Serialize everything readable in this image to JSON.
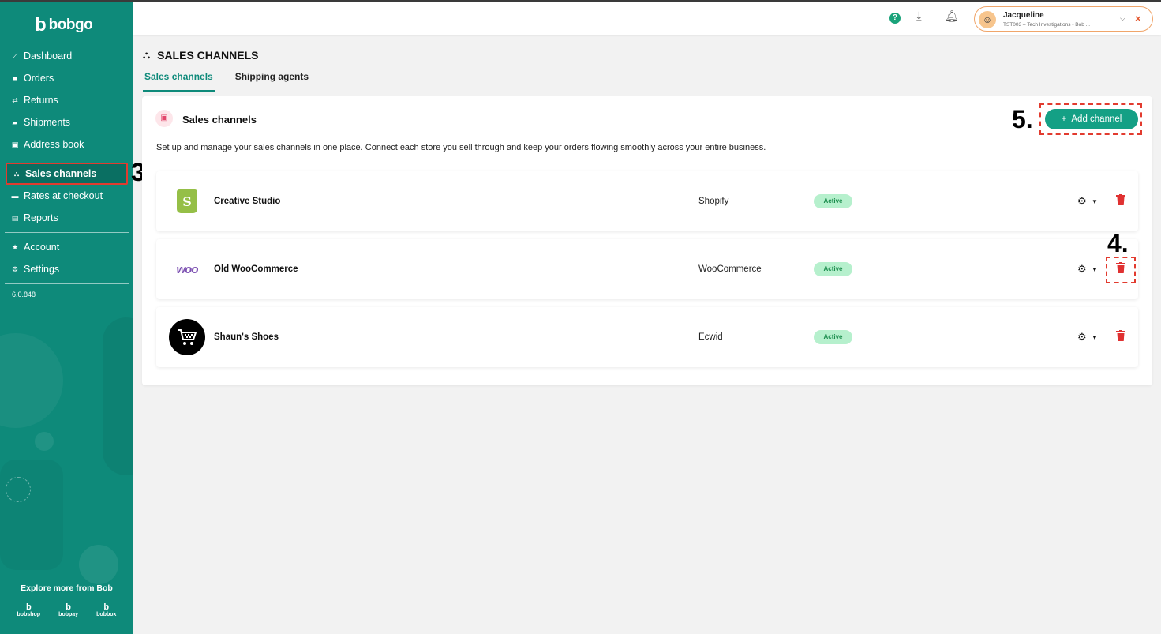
{
  "app": {
    "logo_text": "bobgo",
    "logo_mark": "b",
    "version": "6.0.848"
  },
  "sidebar": {
    "items": [
      {
        "label": "Dashboard",
        "icon": "chart-line-icon"
      },
      {
        "label": "Orders",
        "icon": "bag-icon"
      },
      {
        "label": "Returns",
        "icon": "swap-arrows-icon"
      },
      {
        "label": "Shipments",
        "icon": "truck-icon"
      },
      {
        "label": "Address book",
        "icon": "address-book-icon"
      },
      {
        "label": "Sales channels",
        "icon": "sitemap-icon",
        "active": true
      },
      {
        "label": "Rates at checkout",
        "icon": "cart-icon"
      },
      {
        "label": "Reports",
        "icon": "document-icon"
      },
      {
        "label": "Account",
        "icon": "star-icon"
      },
      {
        "label": "Settings",
        "icon": "gear-icon"
      }
    ],
    "explore_label": "Explore more from Bob",
    "brands": [
      "bobshop",
      "bobpay",
      "bobbox"
    ]
  },
  "topbar": {
    "help_icon": "question-circle-icon",
    "download_icon": "download-icon",
    "bell_icon": "bell-icon",
    "user": {
      "name": "Jacqueline",
      "subtitle": "TST003 – Tech Investigations - Bob ..."
    }
  },
  "page": {
    "title": "SALES CHANNELS",
    "tabs": [
      {
        "label": "Sales channels",
        "active": true
      },
      {
        "label": "Shipping agents",
        "active": false
      }
    ]
  },
  "card": {
    "title": "Sales channels",
    "description": "Set up and manage your sales channels in one place. Connect each store you sell through and keep your orders flowing smoothly across your entire business.",
    "add_button": "Add channel",
    "channels": [
      {
        "name": "Creative Studio",
        "platform": "Shopify",
        "status": "Active",
        "logo": "shopify-logo"
      },
      {
        "name": "Old WooCommerce",
        "platform": "WooCommerce",
        "status": "Active",
        "logo": "woocommerce-logo"
      },
      {
        "name": "Shaun's Shoes",
        "platform": "Ecwid",
        "status": "Active",
        "logo": "ecwid-logo"
      }
    ]
  },
  "annotations": {
    "step3": "3.",
    "step4": "4.",
    "step5": "5."
  },
  "colors": {
    "brand_teal": "#0e8a7a",
    "button_green": "#14a085",
    "active_badge_bg": "#b6f0cd",
    "annotation_red": "#e23b2f",
    "trash_red": "#e03131"
  },
  "woo_logo_text": "woo",
  "shopify_logo_letter": "S"
}
